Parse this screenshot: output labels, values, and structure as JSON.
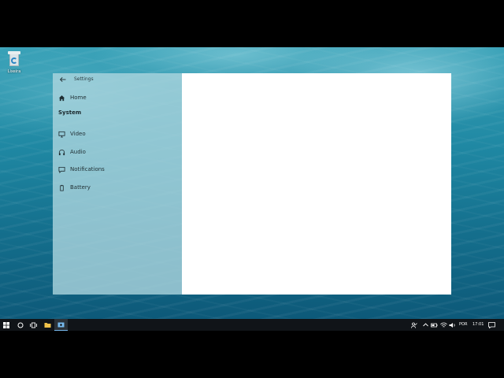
{
  "desktop": {
    "recycle_bin_label": "Lixeira"
  },
  "window": {
    "title": "Settings",
    "nav": {
      "home": "Home",
      "section": "System",
      "items": [
        "Video",
        "Audio",
        "Notifications",
        "Battery"
      ]
    }
  },
  "taskbar": {
    "tray": {
      "language": "POR",
      "time": "17:01"
    }
  },
  "colors": {
    "accent": "#76b9ed",
    "taskbar": "#101418",
    "nav_pane": "#acd6de",
    "content": "#ffffff"
  }
}
